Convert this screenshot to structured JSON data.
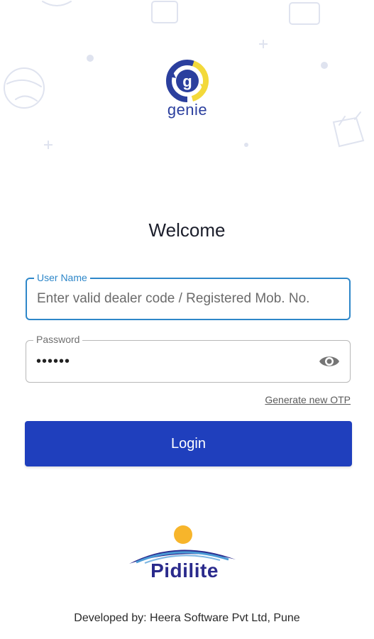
{
  "app": {
    "logo_text": "genie",
    "welcome": "Welcome"
  },
  "form": {
    "username": {
      "label": "User Name",
      "placeholder": "Enter valid dealer code / Registered Mob. No.",
      "value": ""
    },
    "password": {
      "label": "Password",
      "masked_value": "••••••",
      "toggle_icon": "eye-icon"
    },
    "otp_link": "Generate new OTP",
    "login_label": "Login"
  },
  "brand": {
    "name": "Pidilite",
    "primary_color": "#1f3fbd",
    "focus_color": "#2e87c9",
    "sun_color": "#f7b52b"
  },
  "footer": {
    "text": "Developed by: Heera Software Pvt Ltd, Pune"
  }
}
